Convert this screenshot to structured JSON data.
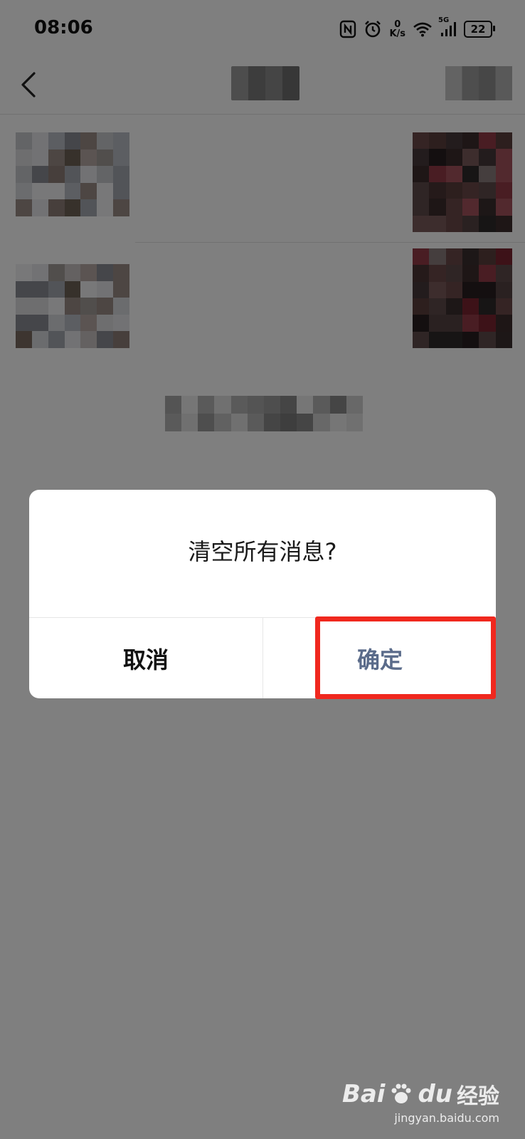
{
  "status_bar": {
    "time": "08:06",
    "net_speed_value": "0",
    "net_speed_unit": "K/s",
    "network_type": "5G",
    "battery": "22",
    "icons": [
      "nfc-icon",
      "alarm-icon",
      "wifi-icon",
      "signal-icon",
      "battery-icon"
    ]
  },
  "nav": {
    "back_icon": "chevron-left-icon",
    "title_redacted": true,
    "action_redacted": true
  },
  "dialog": {
    "title": "清空所有消息?",
    "cancel_label": "取消",
    "confirm_label": "确定"
  },
  "annotation": {
    "highlight_color": "#f0281e",
    "target": "confirm-button"
  },
  "watermark": {
    "brand_latin": "Bai",
    "brand_latin_2": "du",
    "brand_cn": "经验",
    "url": "jingyan.baidu.com"
  },
  "colors": {
    "overlay": "rgba(0,0,0,0.5)",
    "confirm_text": "#5a6b8a",
    "cancel_text": "#111111"
  }
}
